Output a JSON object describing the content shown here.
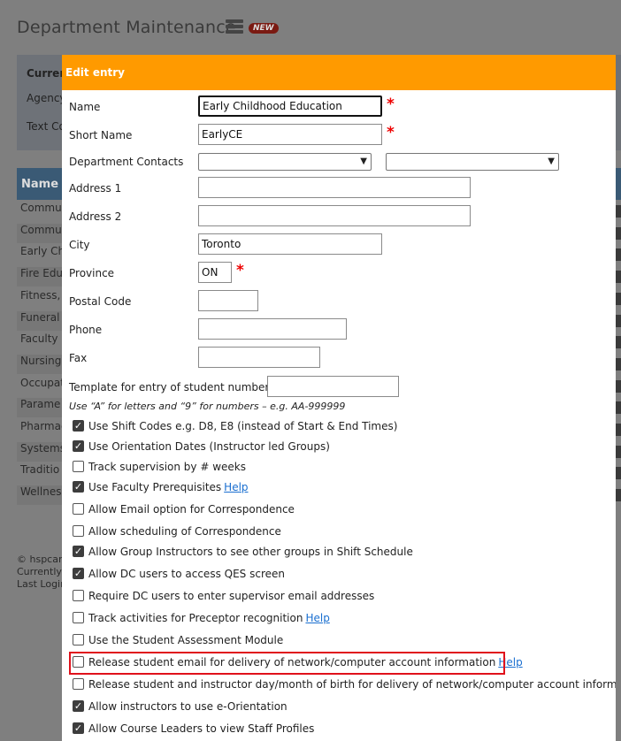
{
  "background": {
    "title": "Department Maintenance",
    "new_badge": "NEW",
    "panel_labels": [
      "Curren",
      "Agency",
      "Text Co"
    ],
    "table_header": "Name",
    "rows": [
      "Commun",
      "Commun",
      "Early Chi",
      "Fire Educ",
      "Fitness, S",
      "Funeral S",
      "Faculty o",
      "Nursing",
      "Occupat",
      "Parame",
      "Pharmac",
      "Systems",
      "Traditio",
      "Wellness"
    ],
    "footer": [
      "© hspcana",
      "Currently s",
      "Last Login"
    ]
  },
  "dialog": {
    "title": "Edit entry",
    "fields": {
      "name": {
        "label": "Name",
        "value": "Early Childhood Education"
      },
      "short_name": {
        "label": "Short Name",
        "value": "EarlyCE"
      },
      "department_contacts": {
        "label": "Department Contacts",
        "value1": "",
        "value2": ""
      },
      "address1": {
        "label": "Address 1",
        "value": ""
      },
      "address2": {
        "label": "Address 2",
        "value": ""
      },
      "city": {
        "label": "City",
        "value": "Toronto"
      },
      "province": {
        "label": "Province",
        "value": "ON"
      },
      "postal_code": {
        "label": "Postal Code",
        "value": ""
      },
      "phone": {
        "label": "Phone",
        "value": ""
      },
      "fax": {
        "label": "Fax",
        "value": ""
      },
      "template": {
        "label": "Template for entry of student numbers",
        "value": ""
      }
    },
    "required_mark": "*",
    "template_hint": "Use “A” for letters and “9” for numbers – e.g. AA-999999",
    "help_label": "Help",
    "options": [
      {
        "label": "Use Shift Codes e.g. D8, E8 (instead of Start & End Times)",
        "checked": true
      },
      {
        "label": "Use Orientation Dates (Instructor led Groups)",
        "checked": true
      },
      {
        "label": "Track supervision by # weeks",
        "checked": false
      },
      {
        "label": "Use Faculty Prerequisites",
        "checked": true
      },
      {
        "label": "Allow Email option for Correspondence",
        "checked": false
      },
      {
        "label": "Allow scheduling of Correspondence",
        "checked": false
      },
      {
        "label": "Allow Group Instructors to see other groups in Shift Schedule",
        "checked": true
      },
      {
        "label": "Allow DC users to access QES screen",
        "checked": true
      },
      {
        "label": "Require DC users to enter supervisor email addresses",
        "checked": false
      },
      {
        "label": "Track activities for Preceptor recognition",
        "checked": false
      },
      {
        "label": "Use the Student Assessment Module",
        "checked": false
      },
      {
        "label": "Release student email for delivery of network/computer account information",
        "checked": false
      },
      {
        "label": "Release student and instructor day/month of birth for delivery of network/computer account information",
        "checked": false
      },
      {
        "label": "Allow instructors to use e-Orientation",
        "checked": true
      },
      {
        "label": "Allow Course Leaders to view Staff Profiles",
        "checked": true
      }
    ]
  }
}
